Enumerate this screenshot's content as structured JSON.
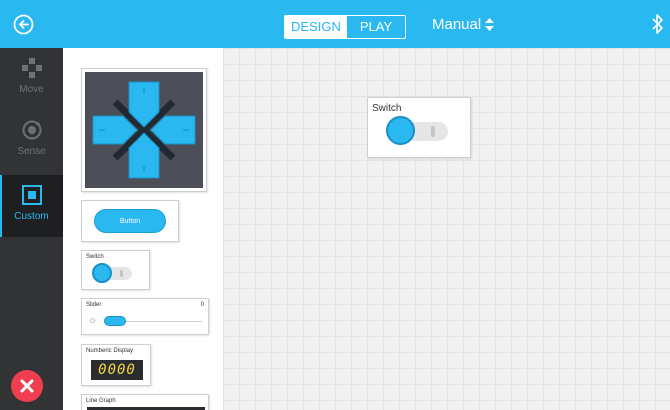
{
  "topbar": {
    "design_label": "DESIGN",
    "play_label": "PLAY",
    "mode_label": "Manual",
    "back_icon": "back-arrow-icon",
    "bluetooth_icon": "bluetooth-icon",
    "accent": "#29b8f0"
  },
  "rail": {
    "items": [
      {
        "label": "Move",
        "icon": "gamepad-icon"
      },
      {
        "label": "Sense",
        "icon": "sensor-icon"
      },
      {
        "label": "Custom",
        "icon": "custom-square-icon",
        "active": true
      }
    ],
    "close_icon": "close-x-icon"
  },
  "palette": {
    "button_label": "Button",
    "switch_title": "Switch",
    "slider_title": "Slider",
    "slider_value": "0",
    "numeric_title": "Numberic Display",
    "numeric_value": "0000",
    "graph_title": "Line Graph"
  },
  "canvas": {
    "switch_title": "Switch"
  },
  "colors": {
    "rail_bg": "#323335",
    "close_red": "#ee3e4f",
    "display_bg": "#2b2c2f",
    "display_digits": "#f6d742"
  }
}
